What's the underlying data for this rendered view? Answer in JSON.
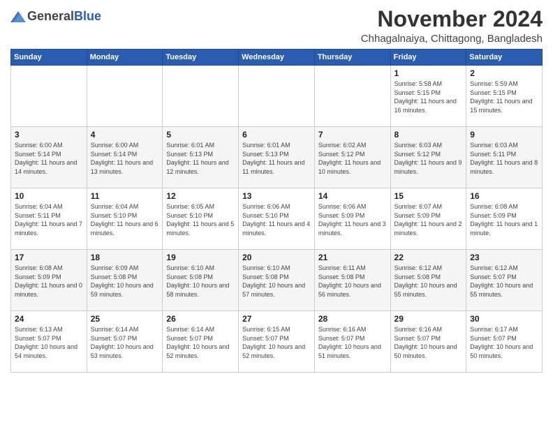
{
  "logo": {
    "general": "General",
    "blue": "Blue"
  },
  "header": {
    "month": "November 2024",
    "location": "Chhagalnaiya, Chittagong, Bangladesh"
  },
  "weekdays": [
    "Sunday",
    "Monday",
    "Tuesday",
    "Wednesday",
    "Thursday",
    "Friday",
    "Saturday"
  ],
  "weeks": [
    [
      null,
      null,
      null,
      null,
      null,
      {
        "day": "1",
        "sunrise": "Sunrise: 5:58 AM",
        "sunset": "Sunset: 5:15 PM",
        "daylight": "Daylight: 11 hours and 16 minutes."
      },
      {
        "day": "2",
        "sunrise": "Sunrise: 5:59 AM",
        "sunset": "Sunset: 5:15 PM",
        "daylight": "Daylight: 11 hours and 15 minutes."
      }
    ],
    [
      {
        "day": "3",
        "sunrise": "Sunrise: 6:00 AM",
        "sunset": "Sunset: 5:14 PM",
        "daylight": "Daylight: 11 hours and 14 minutes."
      },
      {
        "day": "4",
        "sunrise": "Sunrise: 6:00 AM",
        "sunset": "Sunset: 5:14 PM",
        "daylight": "Daylight: 11 hours and 13 minutes."
      },
      {
        "day": "5",
        "sunrise": "Sunrise: 6:01 AM",
        "sunset": "Sunset: 5:13 PM",
        "daylight": "Daylight: 11 hours and 12 minutes."
      },
      {
        "day": "6",
        "sunrise": "Sunrise: 6:01 AM",
        "sunset": "Sunset: 5:13 PM",
        "daylight": "Daylight: 11 hours and 11 minutes."
      },
      {
        "day": "7",
        "sunrise": "Sunrise: 6:02 AM",
        "sunset": "Sunset: 5:12 PM",
        "daylight": "Daylight: 11 hours and 10 minutes."
      },
      {
        "day": "8",
        "sunrise": "Sunrise: 6:03 AM",
        "sunset": "Sunset: 5:12 PM",
        "daylight": "Daylight: 11 hours and 9 minutes."
      },
      {
        "day": "9",
        "sunrise": "Sunrise: 6:03 AM",
        "sunset": "Sunset: 5:11 PM",
        "daylight": "Daylight: 11 hours and 8 minutes."
      }
    ],
    [
      {
        "day": "10",
        "sunrise": "Sunrise: 6:04 AM",
        "sunset": "Sunset: 5:11 PM",
        "daylight": "Daylight: 11 hours and 7 minutes."
      },
      {
        "day": "11",
        "sunrise": "Sunrise: 6:04 AM",
        "sunset": "Sunset: 5:10 PM",
        "daylight": "Daylight: 11 hours and 6 minutes."
      },
      {
        "day": "12",
        "sunrise": "Sunrise: 6:05 AM",
        "sunset": "Sunset: 5:10 PM",
        "daylight": "Daylight: 11 hours and 5 minutes."
      },
      {
        "day": "13",
        "sunrise": "Sunrise: 6:06 AM",
        "sunset": "Sunset: 5:10 PM",
        "daylight": "Daylight: 11 hours and 4 minutes."
      },
      {
        "day": "14",
        "sunrise": "Sunrise: 6:06 AM",
        "sunset": "Sunset: 5:09 PM",
        "daylight": "Daylight: 11 hours and 3 minutes."
      },
      {
        "day": "15",
        "sunrise": "Sunrise: 6:07 AM",
        "sunset": "Sunset: 5:09 PM",
        "daylight": "Daylight: 11 hours and 2 minutes."
      },
      {
        "day": "16",
        "sunrise": "Sunrise: 6:08 AM",
        "sunset": "Sunset: 5:09 PM",
        "daylight": "Daylight: 11 hours and 1 minute."
      }
    ],
    [
      {
        "day": "17",
        "sunrise": "Sunrise: 6:08 AM",
        "sunset": "Sunset: 5:09 PM",
        "daylight": "Daylight: 11 hours and 0 minutes."
      },
      {
        "day": "18",
        "sunrise": "Sunrise: 6:09 AM",
        "sunset": "Sunset: 5:08 PM",
        "daylight": "Daylight: 10 hours and 59 minutes."
      },
      {
        "day": "19",
        "sunrise": "Sunrise: 6:10 AM",
        "sunset": "Sunset: 5:08 PM",
        "daylight": "Daylight: 10 hours and 58 minutes."
      },
      {
        "day": "20",
        "sunrise": "Sunrise: 6:10 AM",
        "sunset": "Sunset: 5:08 PM",
        "daylight": "Daylight: 10 hours and 57 minutes."
      },
      {
        "day": "21",
        "sunrise": "Sunrise: 6:11 AM",
        "sunset": "Sunset: 5:08 PM",
        "daylight": "Daylight: 10 hours and 56 minutes."
      },
      {
        "day": "22",
        "sunrise": "Sunrise: 6:12 AM",
        "sunset": "Sunset: 5:08 PM",
        "daylight": "Daylight: 10 hours and 55 minutes."
      },
      {
        "day": "23",
        "sunrise": "Sunrise: 6:12 AM",
        "sunset": "Sunset: 5:07 PM",
        "daylight": "Daylight: 10 hours and 55 minutes."
      }
    ],
    [
      {
        "day": "24",
        "sunrise": "Sunrise: 6:13 AM",
        "sunset": "Sunset: 5:07 PM",
        "daylight": "Daylight: 10 hours and 54 minutes."
      },
      {
        "day": "25",
        "sunrise": "Sunrise: 6:14 AM",
        "sunset": "Sunset: 5:07 PM",
        "daylight": "Daylight: 10 hours and 53 minutes."
      },
      {
        "day": "26",
        "sunrise": "Sunrise: 6:14 AM",
        "sunset": "Sunset: 5:07 PM",
        "daylight": "Daylight: 10 hours and 52 minutes."
      },
      {
        "day": "27",
        "sunrise": "Sunrise: 6:15 AM",
        "sunset": "Sunset: 5:07 PM",
        "daylight": "Daylight: 10 hours and 52 minutes."
      },
      {
        "day": "28",
        "sunrise": "Sunrise: 6:16 AM",
        "sunset": "Sunset: 5:07 PM",
        "daylight": "Daylight: 10 hours and 51 minutes."
      },
      {
        "day": "29",
        "sunrise": "Sunrise: 6:16 AM",
        "sunset": "Sunset: 5:07 PM",
        "daylight": "Daylight: 10 hours and 50 minutes."
      },
      {
        "day": "30",
        "sunrise": "Sunrise: 6:17 AM",
        "sunset": "Sunset: 5:07 PM",
        "daylight": "Daylight: 10 hours and 50 minutes."
      }
    ]
  ]
}
